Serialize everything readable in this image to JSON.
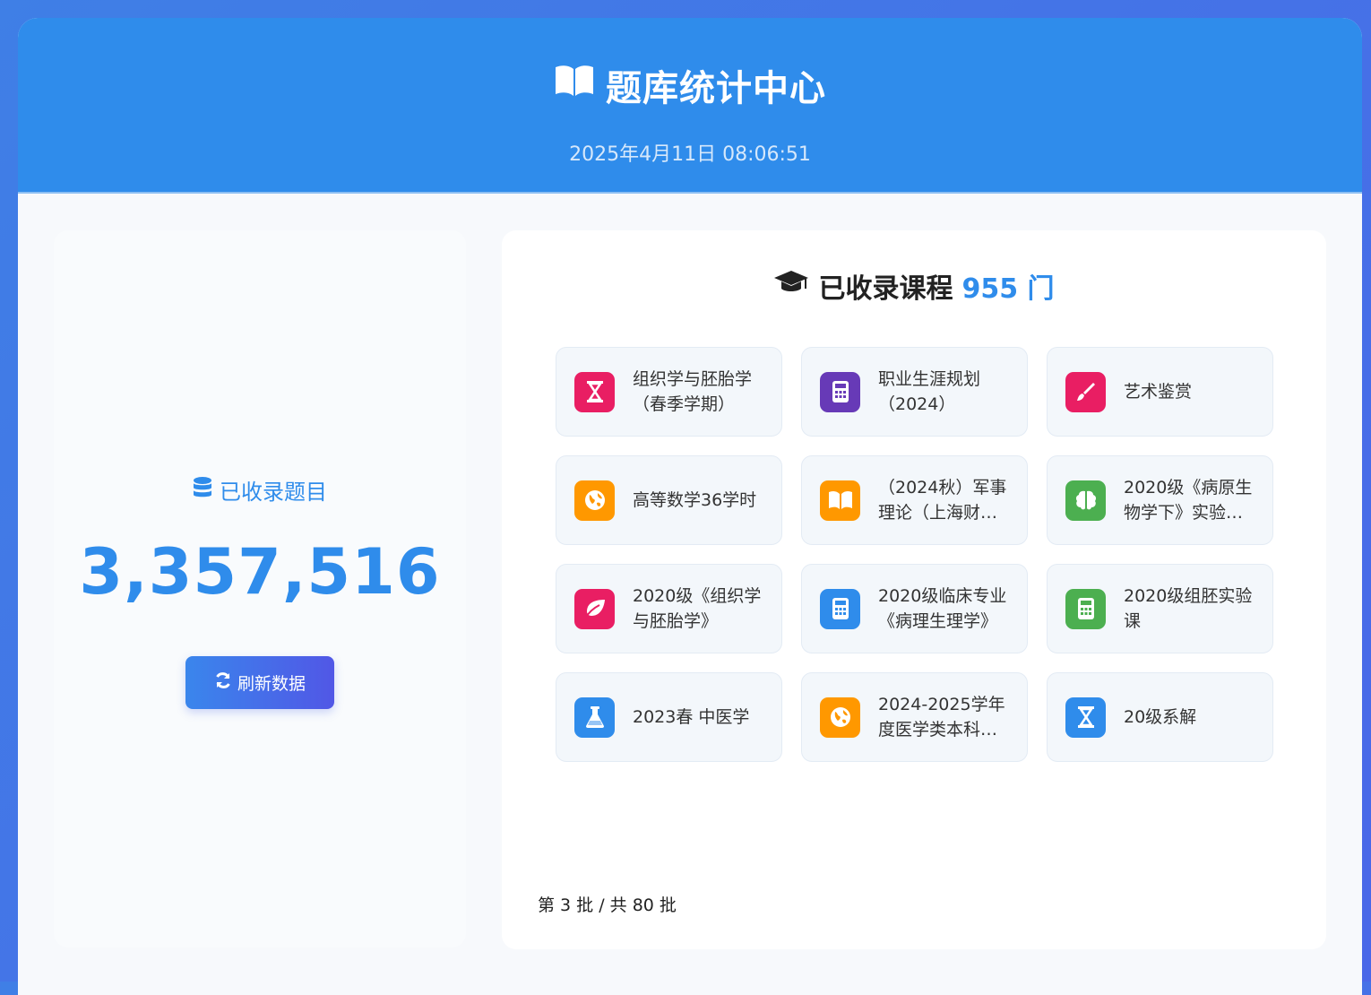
{
  "header": {
    "title": "题库统计中心",
    "datetime": "2025年4月11日 08:06:51"
  },
  "stats": {
    "label": "已收录题目",
    "value": "3,357,516",
    "refresh_label": "刷新数据"
  },
  "courses": {
    "title_prefix": "已收录课程",
    "count": "955 门",
    "items": [
      {
        "name": "组织学与胚胎学（春季学期）",
        "icon": "hourglass-icon",
        "color": "#e91e63"
      },
      {
        "name": "职业生涯规划（2024）",
        "icon": "calculator-icon",
        "color": "#673ab7"
      },
      {
        "name": "艺术鉴赏",
        "icon": "brush-icon",
        "color": "#e91e63"
      },
      {
        "name": "高等数学36学时",
        "icon": "globe-icon",
        "color": "#ff9800"
      },
      {
        "name": "（2024秋）军事理论（上海财…",
        "icon": "book-icon",
        "color": "#ff9800"
      },
      {
        "name": "2020级《病原生物学下》实验…",
        "icon": "brain-icon",
        "color": "#4caf50"
      },
      {
        "name": "2020级《组织学与胚胎学》",
        "icon": "leaf-icon",
        "color": "#e91e63"
      },
      {
        "name": "2020级临床专业《病理生理学》",
        "icon": "calculator-icon",
        "color": "#2f8ceb"
      },
      {
        "name": "2020级组胚实验课",
        "icon": "calculator-icon",
        "color": "#4caf50"
      },
      {
        "name": "2023春 中医学",
        "icon": "flask-icon",
        "color": "#2f8ceb"
      },
      {
        "name": "2024-2025学年度医学类本科…",
        "icon": "globe-icon",
        "color": "#ff9800"
      },
      {
        "name": "20级系解",
        "icon": "hourglass-icon",
        "color": "#2f8ceb"
      }
    ]
  },
  "pager": {
    "text": "第 3 批 / 共 80 批"
  }
}
